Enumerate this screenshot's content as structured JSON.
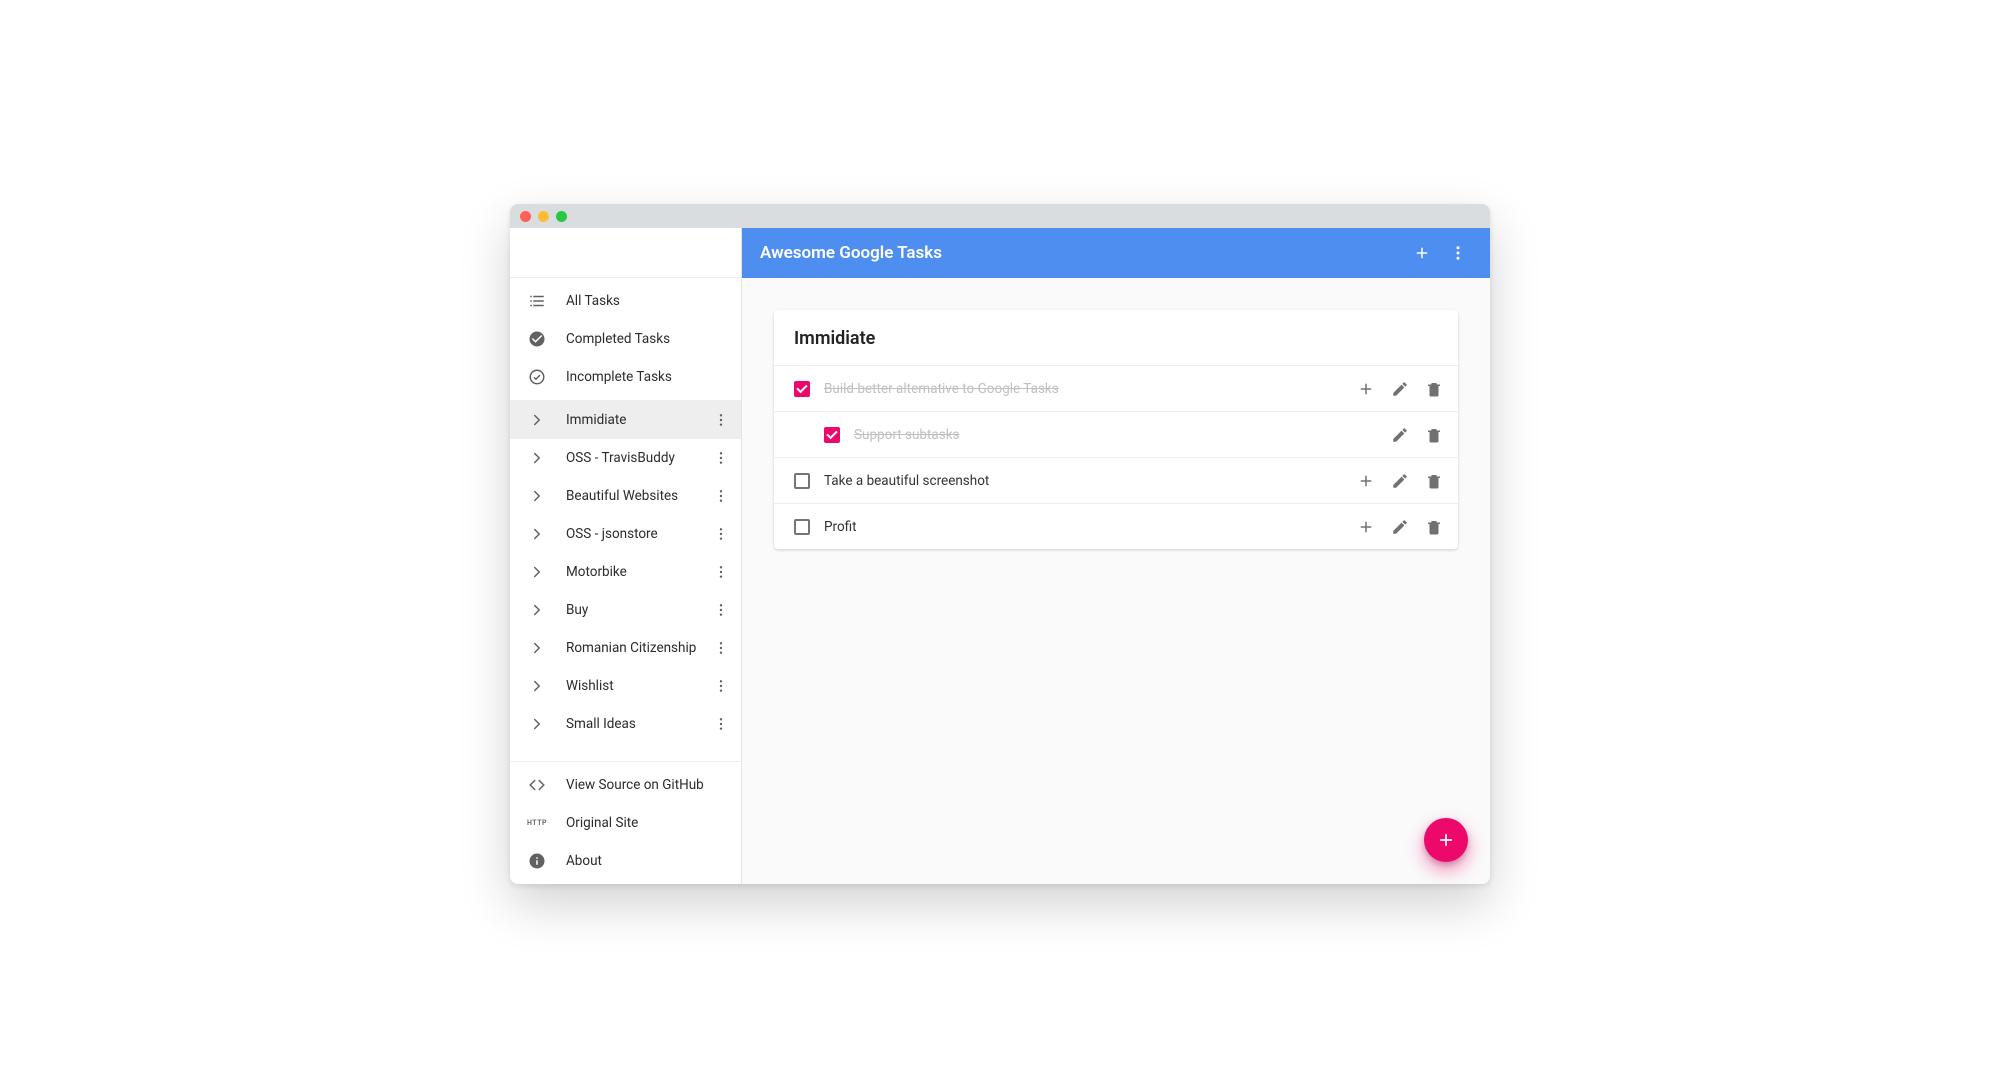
{
  "appbar": {
    "title": "Awesome Google Tasks"
  },
  "sidebar": {
    "filters": [
      {
        "label": "All Tasks"
      },
      {
        "label": "Completed Tasks"
      },
      {
        "label": "Incomplete Tasks"
      }
    ],
    "lists": [
      {
        "label": "Immidiate",
        "active": true
      },
      {
        "label": "OSS - TravisBuddy"
      },
      {
        "label": "Beautiful Websites"
      },
      {
        "label": "OSS - jsonstore"
      },
      {
        "label": "Motorbike"
      },
      {
        "label": "Buy"
      },
      {
        "label": "Romanian Citizenship"
      },
      {
        "label": "Wishlist"
      },
      {
        "label": "Small Ideas"
      }
    ],
    "footer": [
      {
        "label": "View Source on GitHub"
      },
      {
        "label": "Original Site"
      },
      {
        "label": "About"
      }
    ]
  },
  "card": {
    "title": "Immidiate",
    "tasks": [
      {
        "label": "Build better alternative to Google Tasks",
        "done": true,
        "subtask": false,
        "has_add": true
      },
      {
        "label": "Support subtasks",
        "done": true,
        "subtask": true,
        "has_add": false
      },
      {
        "label": "Take a beautiful screenshot",
        "done": false,
        "subtask": false,
        "has_add": true
      },
      {
        "label": "Profit",
        "done": false,
        "subtask": false,
        "has_add": true
      }
    ]
  },
  "colors": {
    "primary": "#4f8ef1",
    "accent": "#ec096b"
  }
}
